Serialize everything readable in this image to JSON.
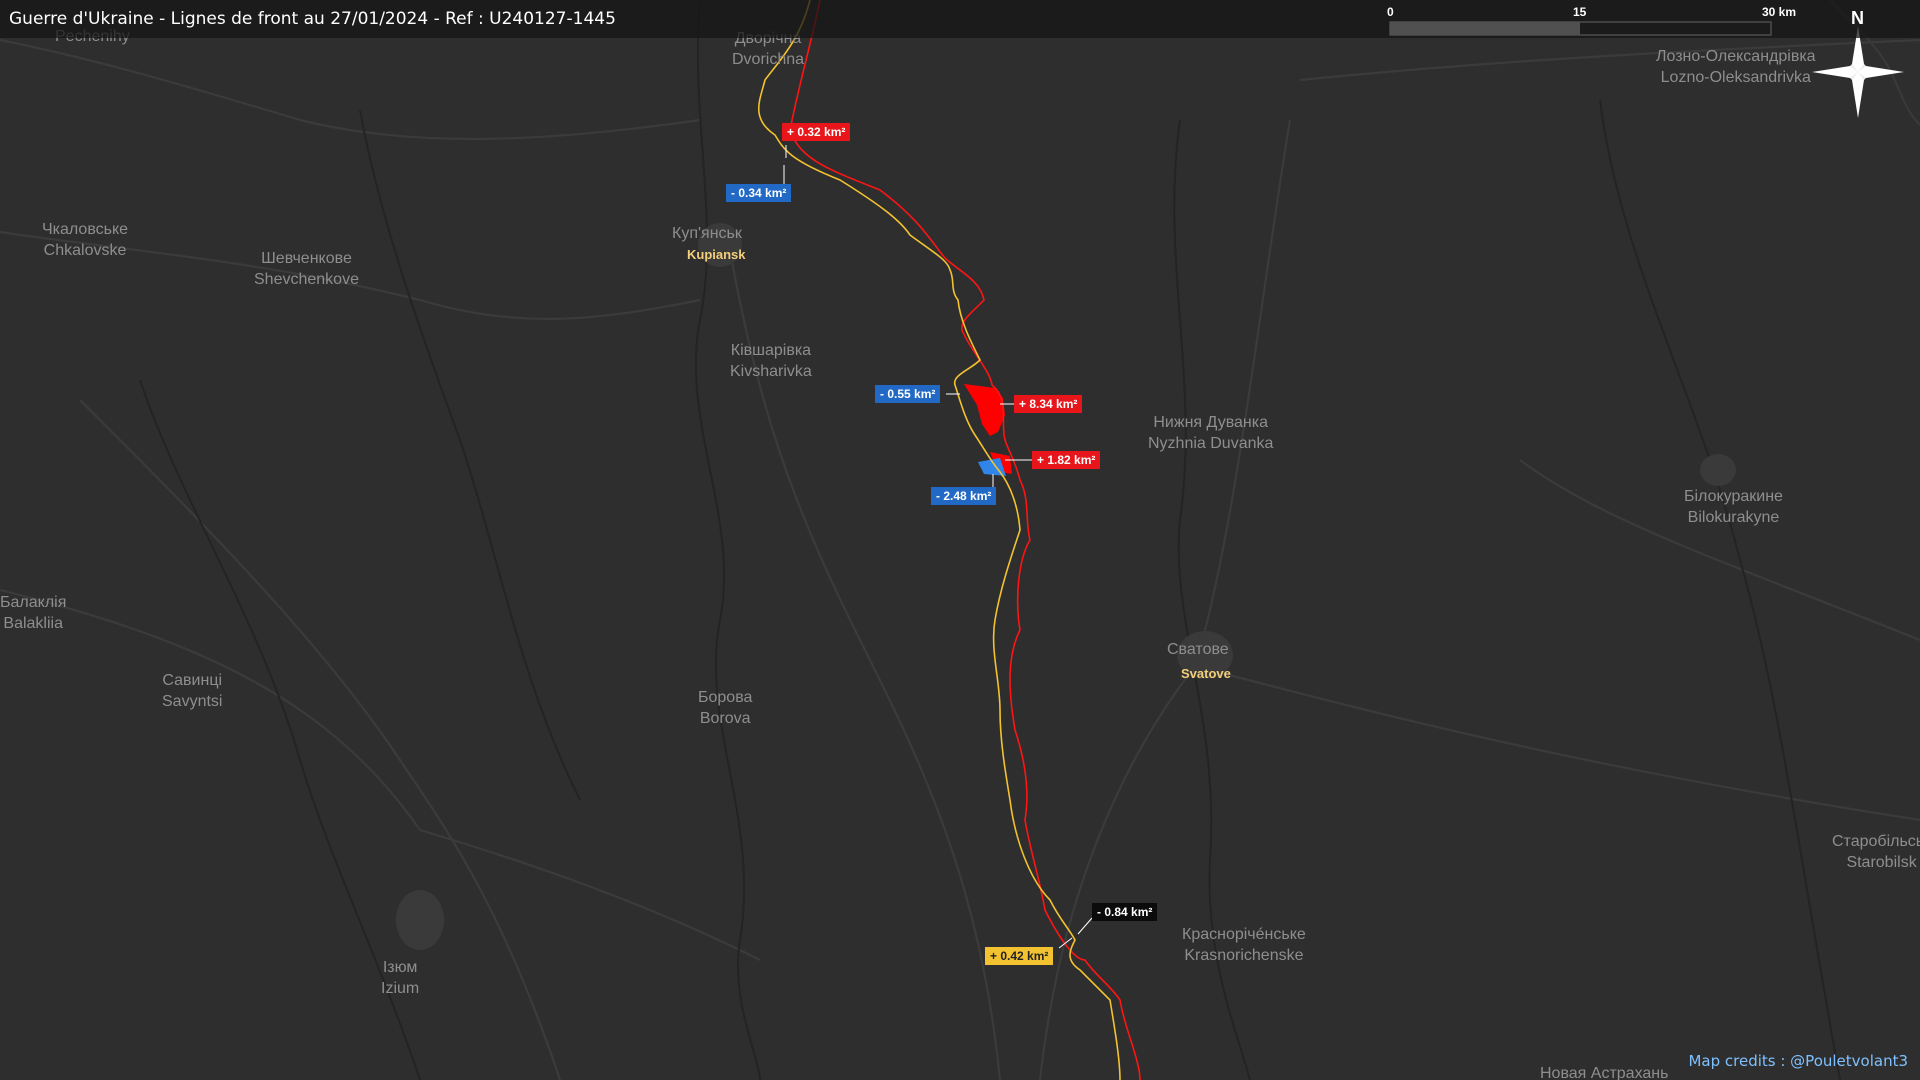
{
  "header": {
    "title": "Guerre d'Ukraine - Lignes de front au 27/01/2024 - Ref : U240127-1445"
  },
  "places": [
    {
      "id": "pechenihy",
      "lines": [
        "Pechenihy"
      ]
    },
    {
      "id": "dvorichna",
      "lines": [
        "Дворічна",
        "Dvorichna"
      ]
    },
    {
      "id": "lozno",
      "lines": [
        "Лозно-Олександрівка",
        "Lozno-Oleksandrivka"
      ]
    },
    {
      "id": "chkalovske",
      "lines": [
        "Чкаловське",
        "Chkalovske"
      ]
    },
    {
      "id": "kupiansk-uk",
      "lines": [
        "Куп'янськ"
      ]
    },
    {
      "id": "shevchenkove",
      "lines": [
        "Шевченкове",
        "Shevchenkove"
      ]
    },
    {
      "id": "kivsharivka",
      "lines": [
        "Ківшарівка",
        "Kivsharivka"
      ]
    },
    {
      "id": "nyzhnia-duvanka",
      "lines": [
        "Нижня Дуванка",
        "Nyzhnia Duvanka"
      ]
    },
    {
      "id": "bilokurakyne",
      "lines": [
        "Білокуракине",
        "Bilokurakyne"
      ]
    },
    {
      "id": "balakliia",
      "lines": [
        "Балаклія",
        "Balakliia"
      ]
    },
    {
      "id": "svatove-uk",
      "lines": [
        "Сватове"
      ]
    },
    {
      "id": "savyntsi",
      "lines": [
        "Савинці",
        "Savyntsi"
      ]
    },
    {
      "id": "borova",
      "lines": [
        "Борова",
        "Borova"
      ]
    },
    {
      "id": "starobilsk",
      "lines": [
        "Старобільськ",
        "Starobilsk"
      ]
    },
    {
      "id": "izium",
      "lines": [
        "Ізюм",
        "Izium"
      ]
    },
    {
      "id": "krasnorichenske",
      "lines": [
        "Краснорічéнське",
        "Krasnorichenske"
      ]
    },
    {
      "id": "novaya-astrakhan",
      "lines": [
        "Новая Астрахань"
      ]
    }
  ],
  "cities": [
    {
      "id": "kupiansk",
      "label": "Kupiansk"
    },
    {
      "id": "svatove",
      "label": "Svatove"
    }
  ],
  "area_changes": [
    {
      "id": "gain-1",
      "text": "+ 0.32 km²",
      "color": "#e8161b"
    },
    {
      "id": "loss-1",
      "text": "- 0.34 km²",
      "color": "#2169c4"
    },
    {
      "id": "loss-2",
      "text": "- 0.55 km²",
      "color": "#2169c4"
    },
    {
      "id": "gain-2",
      "text": "+ 8.34 km²",
      "color": "#e8161b"
    },
    {
      "id": "gain-3",
      "text": "+ 1.82 km²",
      "color": "#e8161b"
    },
    {
      "id": "loss-3",
      "text": "- 2.48 km²",
      "color": "#2169c4"
    },
    {
      "id": "neutral-1",
      "text": "- 0.84 km²",
      "color": "#0b0b0b"
    },
    {
      "id": "neutral-2",
      "text": "+ 0.42 km²",
      "color": "#f2c230"
    }
  ],
  "scale": {
    "ticks": [
      "0",
      "15",
      "30 km"
    ]
  },
  "compass": {
    "letter": "N",
    "icon": "compass-rose-icon"
  },
  "credits": "Map credits : @Pouletvolant3",
  "colors": {
    "background": "#2e2e2e",
    "russian_line": "#e8161b",
    "ukrainian_line": "#f2c230",
    "roads": "#3a3a3a",
    "rivers": "#252525"
  }
}
